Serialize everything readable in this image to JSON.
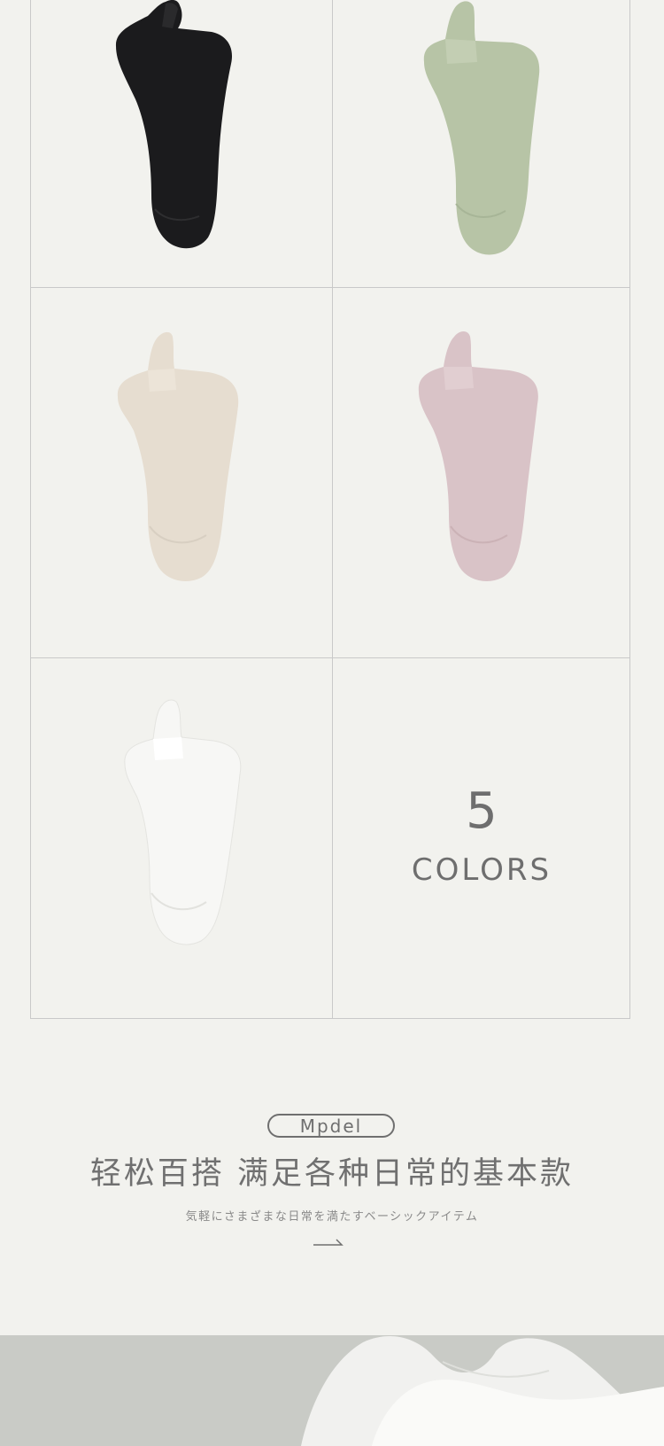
{
  "products": [
    {
      "color_name": "black",
      "hex": "#1b1b1d"
    },
    {
      "color_name": "sage green",
      "hex": "#b7c4a6"
    },
    {
      "color_name": "beige",
      "hex": "#e6ddd0"
    },
    {
      "color_name": "dusty pink",
      "hex": "#d9c3c7"
    },
    {
      "color_name": "white",
      "hex": "#f5f5f3"
    }
  ],
  "colors_panel": {
    "count": "5",
    "label": "COLORS"
  },
  "brand_badge": "Mpdel",
  "headline": "轻松百搭 满足各种日常的基本款",
  "subline": "気軽にさまざまな日常を満たすベーシックアイテム",
  "icons": {
    "arrow": "arrow-right-icon"
  },
  "theme": {
    "background": "#f2f2ee",
    "text": "#6f6f6f",
    "grid_line": "#c9c9c9"
  }
}
